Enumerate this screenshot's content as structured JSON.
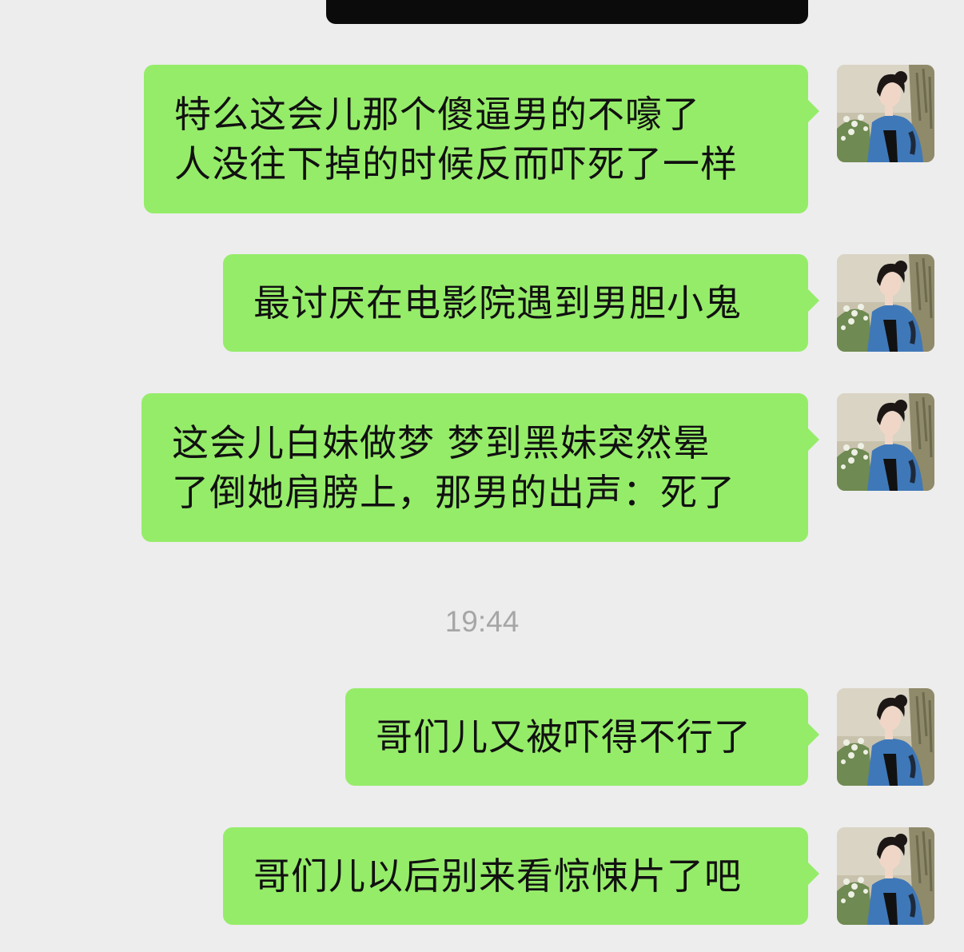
{
  "chat": {
    "timestamp": "19:44",
    "messages": [
      {
        "lines": [
          "特么这会儿那个傻逼男的不嚎了",
          "人没往下掉的时候反而吓死了一样"
        ]
      },
      {
        "lines": [
          "最讨厌在电影院遇到男胆小鬼"
        ]
      },
      {
        "lines": [
          "这会儿白妹做梦 梦到黑妹突然晕",
          "了倒她肩膀上，那男的出声：死了"
        ]
      },
      {
        "lines": [
          "哥们儿又被吓得不行了"
        ]
      },
      {
        "lines": [
          "哥们儿以后别来看惊悚片了吧"
        ]
      }
    ]
  },
  "colors": {
    "background": "#ededed",
    "sent_bubble": "#95ec69",
    "timestamp_text": "#a6a6a6",
    "top_bubble": "#0b0b0b"
  },
  "icons": {
    "avatar": "woman-with-flowers-avatar"
  }
}
